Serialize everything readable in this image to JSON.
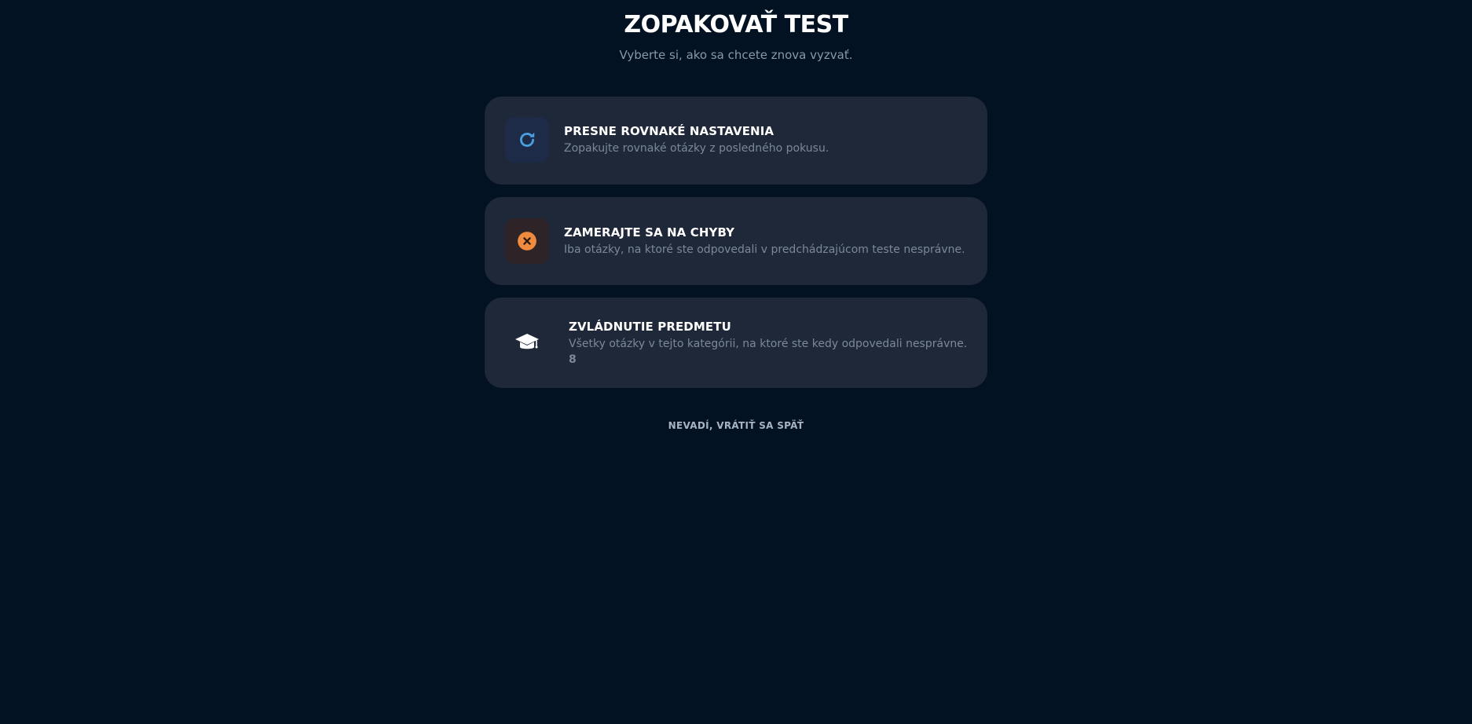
{
  "header": {
    "title": "ZOPAKOVAŤ TEST",
    "subtitle": "Vyberte si, ako sa chcete znova vyzvať."
  },
  "options": [
    {
      "title": "PRESNE ROVNAKÉ NASTAVENIA",
      "description": "Zopakujte rovnaké otázky z posledného pokusu.",
      "icon": "refresh-icon",
      "accent": "#4a9fe0"
    },
    {
      "title": "ZAMERAJTE SA NA CHYBY",
      "description": "Iba otázky, na ktoré ste odpovedali v predchádzajúcom teste nesprávne.",
      "icon": "close-circle-icon",
      "accent": "#f08a3e"
    },
    {
      "title": "ZVLÁDNUTIE PREDMETU",
      "description": "Všetky otázky v tejto kategórii, na ktoré ste kedy odpovedali nesprávne.",
      "count": "8",
      "icon": "graduation-cap-icon",
      "accent": "#ffffff"
    }
  ],
  "footer": {
    "back_label": "NEVADÍ, VRÁTIŤ SA SPÄŤ"
  },
  "colors": {
    "background": "#021222",
    "card": "#1f2838"
  }
}
